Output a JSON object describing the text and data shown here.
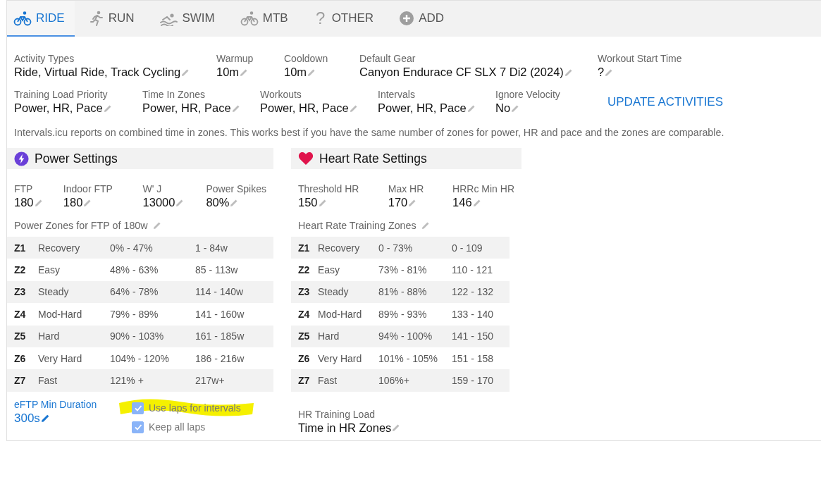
{
  "tabs": [
    {
      "label": "RIDE",
      "kind": "bike",
      "selected": true
    },
    {
      "label": "RUN",
      "kind": "run",
      "selected": false
    },
    {
      "label": "SWIM",
      "kind": "swim",
      "selected": false
    },
    {
      "label": "MTB",
      "kind": "bike",
      "selected": false
    },
    {
      "label": "OTHER",
      "kind": "char",
      "icon_text": "?",
      "selected": false
    },
    {
      "label": "ADD",
      "kind": "plus",
      "selected": false
    }
  ],
  "settings_rows": [
    [
      {
        "label": "Activity Types",
        "value": "Ride, Virtual Ride, Track Cycling"
      },
      {
        "label": "Warmup",
        "value": "10m"
      },
      {
        "label": "Cooldown",
        "value": "10m"
      },
      {
        "label": "Default Gear",
        "value": "Canyon Endurace CF SLX 7 Di2 (2024)"
      },
      {
        "label": "Workout Start Time",
        "value": "?"
      }
    ],
    [
      {
        "label": "Training Load Priority",
        "value": "Power, HR, Pace"
      },
      {
        "label": "Time In Zones",
        "value": "Power, HR, Pace"
      },
      {
        "label": "Workouts",
        "value": "Power, HR, Pace"
      },
      {
        "label": "Intervals",
        "value": "Power, HR, Pace"
      },
      {
        "label": "Ignore Velocity",
        "value": "No"
      }
    ]
  ],
  "update_button": "UPDATE ACTIVITIES",
  "note": "Intervals.icu reports on combined time in zones. This works best if you have the same number of zones for power, HR and pace and the zones are comparable.",
  "panels": [
    {
      "kind": "power",
      "title": "Power Settings",
      "fields": [
        {
          "label": "FTP",
          "value": "180"
        },
        {
          "label": "Indoor FTP",
          "value": "180"
        },
        {
          "label": "W' J",
          "value": "13000"
        },
        {
          "label": "Power Spikes",
          "value": "80%"
        }
      ],
      "zones_title": "Power Zones for FTP of 180w",
      "zones": [
        {
          "zone": "Z1",
          "name": "Recovery",
          "percent": "0% - 47%",
          "range": "1 - 84w"
        },
        {
          "zone": "Z2",
          "name": "Easy",
          "percent": "48% - 63%",
          "range": "85 - 113w"
        },
        {
          "zone": "Z3",
          "name": "Steady",
          "percent": "64% - 78%",
          "range": "114 - 140w"
        },
        {
          "zone": "Z4",
          "name": "Mod-Hard",
          "percent": "79% - 89%",
          "range": "141 - 160w"
        },
        {
          "zone": "Z5",
          "name": "Hard",
          "percent": "90% - 103%",
          "range": "161 - 185w"
        },
        {
          "zone": "Z6",
          "name": "Very Hard",
          "percent": "104% - 120%",
          "range": "186 - 216w"
        },
        {
          "zone": "Z7",
          "name": "Fast",
          "percent": "121% +",
          "range": "217w+"
        }
      ]
    },
    {
      "kind": "heart",
      "title": "Heart Rate Settings",
      "fields": [
        {
          "label": "Threshold HR",
          "value": "150"
        },
        {
          "label": "Max HR",
          "value": "170"
        },
        {
          "label": "HRRc Min HR",
          "value": "146"
        }
      ],
      "zones_title": "Heart Rate Training Zones",
      "zones": [
        {
          "zone": "Z1",
          "name": "Recovery",
          "percent": "0 - 73%",
          "range": "0 - 109"
        },
        {
          "zone": "Z2",
          "name": "Easy",
          "percent": "73% - 81%",
          "range": "110 - 121"
        },
        {
          "zone": "Z3",
          "name": "Steady",
          "percent": "81% - 88%",
          "range": "122 - 132"
        },
        {
          "zone": "Z4",
          "name": "Mod-Hard",
          "percent": "89% - 93%",
          "range": "133 - 140"
        },
        {
          "zone": "Z5",
          "name": "Hard",
          "percent": "94% - 100%",
          "range": "141 - 150"
        },
        {
          "zone": "Z6",
          "name": "Very Hard",
          "percent": "101% - 105%",
          "range": "151 - 158"
        },
        {
          "zone": "Z7",
          "name": "Fast",
          "percent": "106%+",
          "range": "159 - 170"
        }
      ]
    }
  ],
  "eftp": {
    "label": "eFTP Min Duration",
    "value": "300s"
  },
  "checkboxes": [
    {
      "label": "Use laps for intervals",
      "checked": true,
      "highlighted": true
    },
    {
      "label": "Keep all laps",
      "checked": true,
      "highlighted": false
    }
  ],
  "hr_training_load": {
    "label": "HR Training Load",
    "value": "Time in HR Zones"
  }
}
